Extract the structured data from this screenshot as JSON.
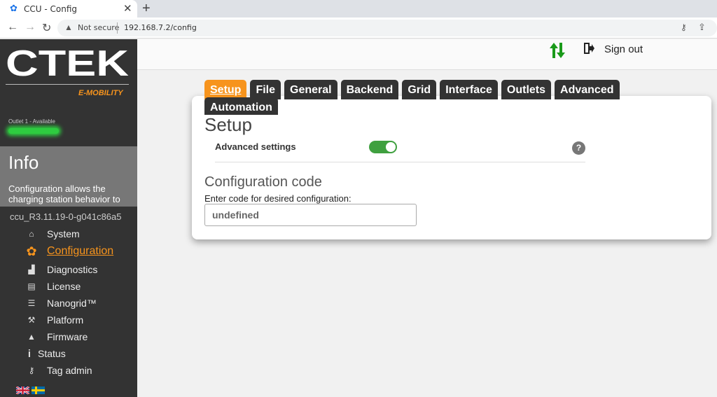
{
  "browser": {
    "tab_title": "CCU - Config",
    "new_tab": "+",
    "close": "✕",
    "not_secure": "Not secure",
    "url": "192.168.7.2/config"
  },
  "sidebar": {
    "logo_text": "CTEK",
    "logo_sub": "E-MOBILITY",
    "outlet_status": "Outlet 1 - Available",
    "info_title": "Info",
    "info_text": "Configuration allows the charging station behavior to",
    "version": "ccu_R3.11.19-0-g041c86a5",
    "nav": [
      {
        "label": "System",
        "icon": "home-icon",
        "glyph": "⌂"
      },
      {
        "label": "Configuration",
        "icon": "gear-icon",
        "glyph": "✿",
        "active": true
      },
      {
        "label": "Diagnostics",
        "icon": "bar-chart-icon",
        "glyph": "▟"
      },
      {
        "label": "License",
        "icon": "license-icon",
        "glyph": "▤"
      },
      {
        "label": "Nanogrid™",
        "icon": "sliders-icon",
        "glyph": "☰"
      },
      {
        "label": "Platform",
        "icon": "wrench-icon",
        "glyph": "⚒"
      },
      {
        "label": "Firmware",
        "icon": "upload-folder-icon",
        "glyph": "▲"
      },
      {
        "label": "Status",
        "icon": "info-icon",
        "glyph": "i"
      },
      {
        "label": "Tag admin",
        "icon": "key-icon",
        "glyph": "⚷"
      }
    ]
  },
  "header": {
    "signout": "Sign out"
  },
  "tabs": [
    "Setup",
    "File",
    "General",
    "Backend",
    "Grid",
    "Interface",
    "Outlets",
    "Advanced"
  ],
  "tab_automation": "Automation",
  "setup": {
    "title": "Setup",
    "advanced_label": "Advanced settings",
    "advanced_on": true,
    "help": "?",
    "config_title": "Configuration code",
    "code_label": "Enter code for desired configuration:",
    "code_value": "undefined"
  },
  "colors": {
    "accent": "#f7941d",
    "sidebar": "#333333",
    "status_green": "#2ecc40"
  }
}
